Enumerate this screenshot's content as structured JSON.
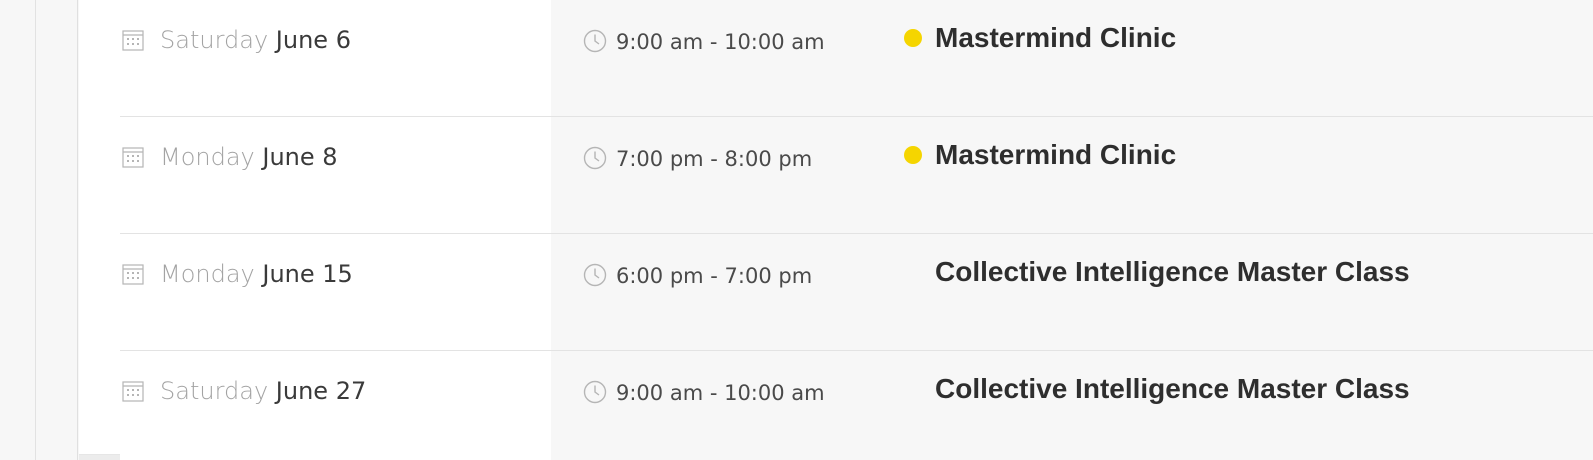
{
  "events": [
    {
      "weekday": "Saturday",
      "date": "June 6",
      "time": "9:00 am - 10:00 am",
      "title": "Mastermind Clinic",
      "has_dot": true
    },
    {
      "weekday": "Monday",
      "date": "June 8",
      "time": "7:00 pm - 8:00 pm",
      "title": "Mastermind Clinic",
      "has_dot": true
    },
    {
      "weekday": "Monday",
      "date": "June 15",
      "time": "6:00 pm - 7:00 pm",
      "title": "Collective Intelligence Master Class",
      "has_dot": false
    },
    {
      "weekday": "Saturday",
      "date": "June 27",
      "time": "9:00 am - 10:00 am",
      "title": "Collective Intelligence Master Class",
      "has_dot": false
    }
  ],
  "icons": {
    "date": "calendar-icon",
    "time": "clock-icon"
  },
  "colors": {
    "dot": "#f5d500",
    "title": "#2e2e2e",
    "weekday": "#a3a3a3",
    "date": "#3a3a3a",
    "time": "#4a4a4a"
  }
}
